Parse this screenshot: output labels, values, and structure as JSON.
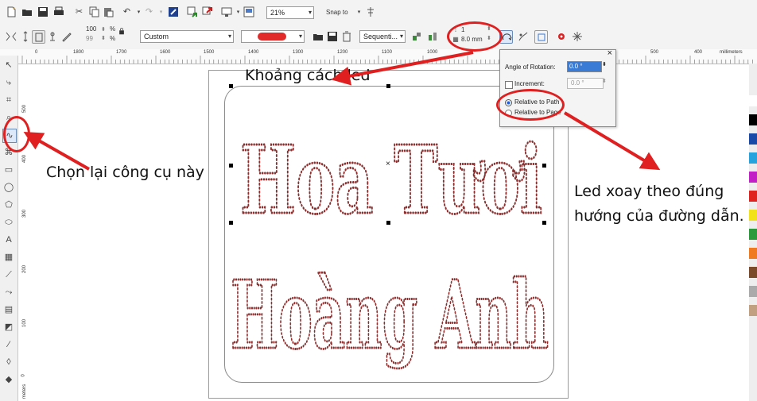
{
  "toolbar": {
    "zoom": "21%",
    "snap_to": "Snap to",
    "scale_w": "100",
    "scale_h": "99",
    "percent": "%",
    "preset": "Custom",
    "method": "Sequenti...",
    "objects": "1",
    "spacing": "8.0 mm"
  },
  "ruler": {
    "top_labels": [
      "0",
      "1800",
      "1700",
      "1600",
      "1500",
      "1400",
      "1300",
      "1200",
      "1100",
      "1000",
      "500",
      "400"
    ],
    "unit": "millimeters",
    "left_labels": [
      "500",
      "400",
      "300",
      "200",
      "100",
      "0"
    ],
    "left_unit": "meters"
  },
  "popup": {
    "angle_label": "Angle of Rotation:",
    "angle_value": "0.0 °",
    "increment_label": "Increment:",
    "increment_value": "0.0 °",
    "relative_path": "Relative to Path",
    "relative_page": "Relative to Page",
    "close": "×"
  },
  "artwork": {
    "line1": "Hoa Tươi",
    "line2": "Hoàng Anh"
  },
  "annotations": {
    "khoang_cach": "Khoảng cách led",
    "chon_lai": "Chọn lại công cụ này",
    "led_xoay_1": "Led xoay theo đúng",
    "led_xoay_2": "hướng của đường dẫn."
  },
  "colors": {
    "annotation_red": "#e02020",
    "led_dot": "#8b2f2f",
    "preview_fill": "#e12a2a",
    "selected_blue": "#3a7bd5"
  },
  "palette": [
    "#ffffff",
    "#000000",
    "#1a4aa8",
    "#26a3dd",
    "#c21fc6",
    "#e0231f",
    "#f2e21a",
    "#2a9a3a",
    "#f07a20",
    "#7a4a2a",
    "#aaaaaa",
    "#c0a080"
  ]
}
